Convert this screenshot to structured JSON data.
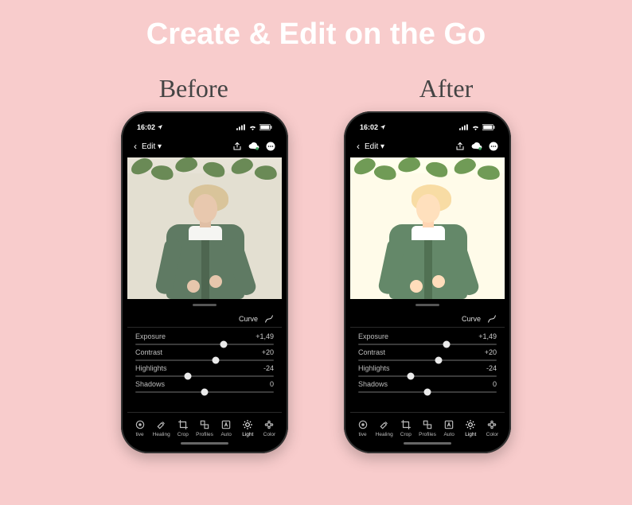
{
  "headline": "Create & Edit on the Go",
  "before_label": "Before",
  "after_label": "After",
  "status": {
    "time": "16:02",
    "location_icon": "location-icon"
  },
  "app_nav": {
    "back": "‹",
    "title": "Edit",
    "dropdown": "▾",
    "share_icon": "share-icon",
    "cloud_icon": "cloud-sync-icon",
    "more_icon": "more-icon"
  },
  "curve": {
    "label": "Curve"
  },
  "sliders": [
    {
      "name": "Exposure",
      "value": "+1,49",
      "pos": 64
    },
    {
      "name": "Contrast",
      "value": "+20",
      "pos": 58
    },
    {
      "name": "Highlights",
      "value": "-24",
      "pos": 38
    },
    {
      "name": "Shadows",
      "value": "0",
      "pos": 50
    }
  ],
  "tools": [
    {
      "key": "selective",
      "label": "tive",
      "icon": "selective-icon"
    },
    {
      "key": "healing",
      "label": "Healing",
      "icon": "healing-icon"
    },
    {
      "key": "crop",
      "label": "Crop",
      "icon": "crop-icon"
    },
    {
      "key": "profiles",
      "label": "Profiles",
      "icon": "profiles-icon"
    },
    {
      "key": "auto",
      "label": "Auto",
      "icon": "auto-icon"
    },
    {
      "key": "light",
      "label": "Light",
      "icon": "light-icon",
      "active": true
    },
    {
      "key": "color",
      "label": "Color",
      "icon": "color-icon"
    }
  ]
}
